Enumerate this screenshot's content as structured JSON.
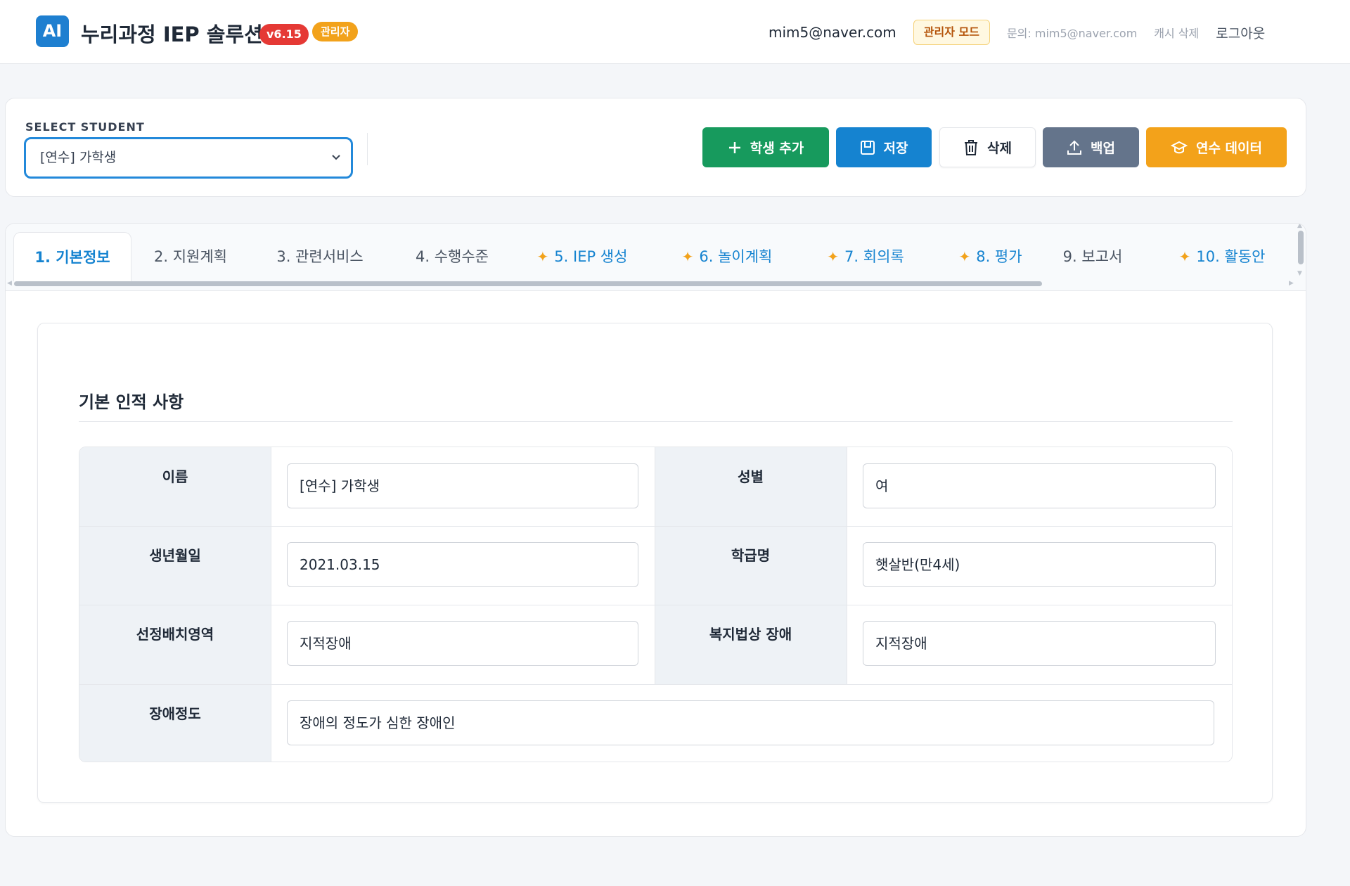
{
  "header": {
    "logo_text": "AI",
    "app_title": "누리과정 IEP 솔루션",
    "version": "v6.15",
    "role_badge": "관리자",
    "user_email": "mim5@naver.com",
    "mode_badge": "관리자 모드",
    "contact": "문의: mim5@naver.com",
    "cache_clear": "캐시 삭제",
    "logout": "로그아웃"
  },
  "selector": {
    "label": "SELECT STUDENT",
    "selected": "[연수] 가학생"
  },
  "toolbar": {
    "add_student": "학생 추가",
    "save": "저장",
    "delete": "삭제",
    "backup": "백업",
    "training_data": "연수 데이터"
  },
  "tabs": [
    {
      "label": "1. 기본정보",
      "ai": false,
      "active": true
    },
    {
      "label": "2. 지원계획",
      "ai": false,
      "active": false
    },
    {
      "label": "3. 관련서비스",
      "ai": false,
      "active": false
    },
    {
      "label": "4. 수행수준",
      "ai": false,
      "active": false
    },
    {
      "label": "5. IEP 생성",
      "ai": true,
      "active": false
    },
    {
      "label": "6. 놀이계획",
      "ai": true,
      "active": false
    },
    {
      "label": "7. 회의록",
      "ai": true,
      "active": false
    },
    {
      "label": "8. 평가",
      "ai": true,
      "active": false
    },
    {
      "label": "9. 보고서",
      "ai": false,
      "active": false
    },
    {
      "label": "10. 활동안",
      "ai": true,
      "active": false
    }
  ],
  "basic_info": {
    "section_title": "기본 인적 사항",
    "name_label": "이름",
    "name_value": "[연수] 가학생",
    "gender_label": "성별",
    "gender_value": "여",
    "birth_label": "생년월일",
    "birth_value": "2021.03.15",
    "class_label": "학급명",
    "class_value": "햇살반(만4세)",
    "placement_label": "선정배치영역",
    "placement_value": "지적장애",
    "welfare_label": "복지법상 장애",
    "welfare_value": "지적장애",
    "severity_label": "장애정도",
    "severity_value": "장애의 정도가 심한 장애인"
  },
  "colors": {
    "primary": "#1583d0",
    "success": "#179a5d",
    "warning": "#f3a21a",
    "danger": "#e53935",
    "slate": "#64748b"
  }
}
